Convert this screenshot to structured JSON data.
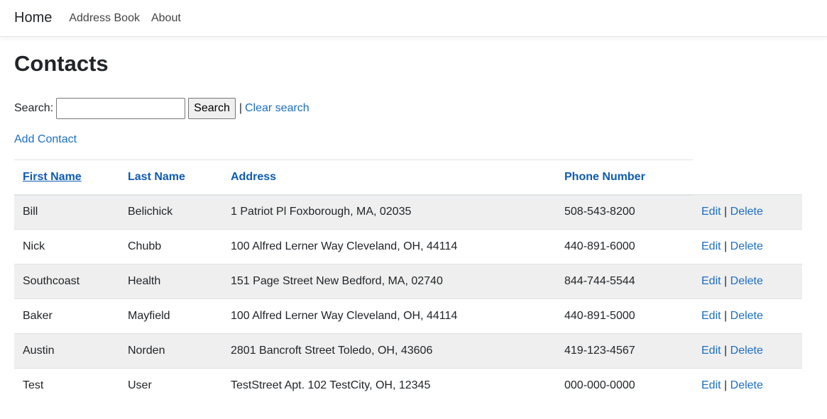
{
  "nav": {
    "brand": "Home",
    "links": [
      "Address Book",
      "About"
    ]
  },
  "page": {
    "title": "Contacts"
  },
  "search": {
    "label": "Search:",
    "value": "",
    "button_label": "Search",
    "separator": "|",
    "clear_label": "Clear search"
  },
  "add_contact_label": "Add Contact",
  "table": {
    "headers": [
      "First Name",
      "Last Name",
      "Address",
      "Phone Number"
    ],
    "edit_label": "Edit",
    "delete_label": "Delete",
    "action_separator": "|",
    "rows": [
      {
        "first": "Bill",
        "last": "Belichick",
        "address": "1 Patriot Pl Foxborough, MA, 02035",
        "phone": "508-543-8200"
      },
      {
        "first": "Nick",
        "last": "Chubb",
        "address": "100 Alfred Lerner Way Cleveland, OH, 44114",
        "phone": "440-891-6000"
      },
      {
        "first": "Southcoast",
        "last": "Health",
        "address": "151 Page Street New Bedford, MA, 02740",
        "phone": "844-744-5544"
      },
      {
        "first": "Baker",
        "last": "Mayfield",
        "address": "100 Alfred Lerner Way Cleveland, OH, 44114",
        "phone": "440-891-5000"
      },
      {
        "first": "Austin",
        "last": "Norden",
        "address": "2801 Bancroft Street Toledo, OH, 43606",
        "phone": "419-123-4567"
      },
      {
        "first": "Test",
        "last": "User",
        "address": "TestStreet Apt. 102 TestCity, OH, 12345",
        "phone": "000-000-0000"
      }
    ]
  },
  "colors": {
    "link": "#1b6ec2",
    "header_link": "#0d5bb5",
    "striped_row": "#efefef"
  }
}
